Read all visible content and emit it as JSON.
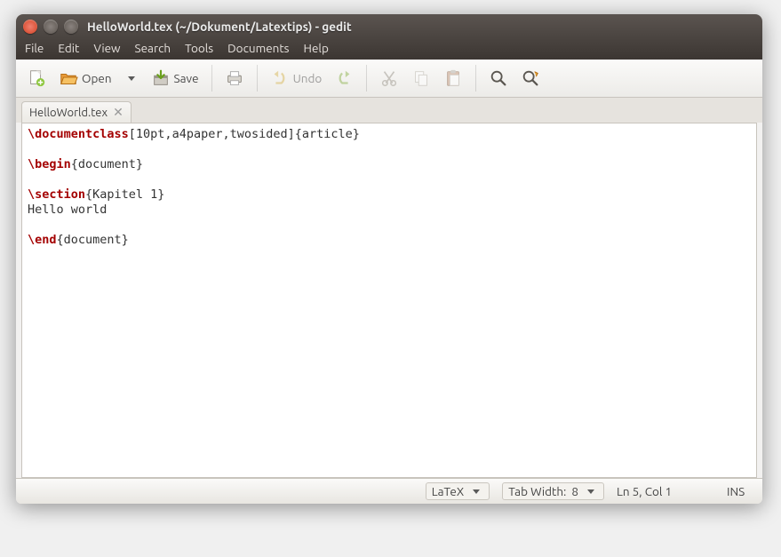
{
  "window": {
    "title": "HelloWorld.tex (~/Dokument/Latextips) - gedit"
  },
  "menu": {
    "file": "File",
    "edit": "Edit",
    "view": "View",
    "search": "Search",
    "tools": "Tools",
    "documents": "Documents",
    "help": "Help"
  },
  "toolbar": {
    "open": "Open",
    "save": "Save",
    "undo": "Undo"
  },
  "tab": {
    "name": "HelloWorld.tex"
  },
  "editor": {
    "l1_kw": "\\documentclass",
    "l1_rest": "[10pt,a4paper,twosided]{article}",
    "l2_kw": "\\begin",
    "l2_rest": "{document}",
    "l3_kw": "\\section",
    "l3_rest": "{Kapitel 1}",
    "l4": "Hello world",
    "l5_kw": "\\end",
    "l5_rest": "{document}"
  },
  "status": {
    "language": "LaTeX",
    "tabwidth_label": "Tab Width:",
    "tabwidth_value": "8",
    "cursor": "Ln 5, Col 1",
    "insert_mode": "INS"
  }
}
